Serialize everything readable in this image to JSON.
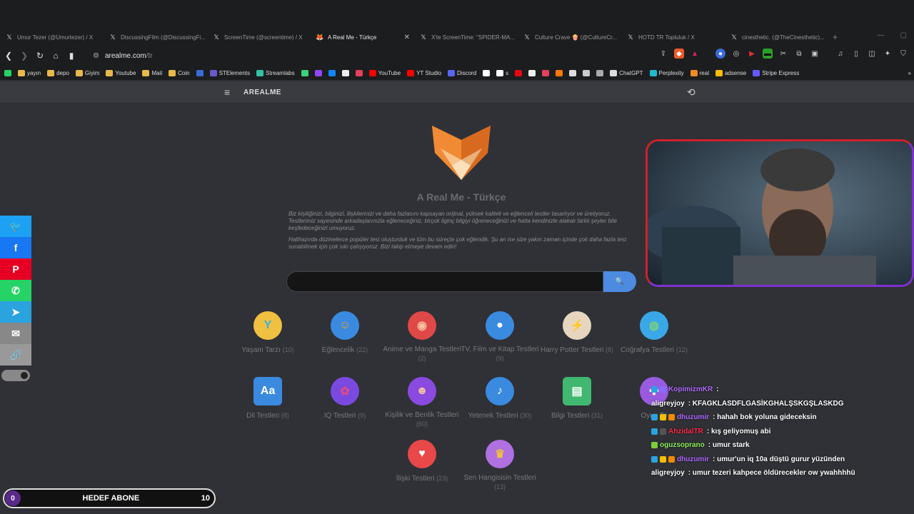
{
  "browser": {
    "tabs": [
      {
        "title": "Umur Tezer (@Umurtezer) / X",
        "icon": "x-icon",
        "active": false
      },
      {
        "title": "DiscussingFilm (@DiscussingFi...",
        "icon": "x-icon",
        "active": false
      },
      {
        "title": "ScreenTime (@screentime) / X",
        "icon": "x-icon",
        "active": false
      },
      {
        "title": "A Real Me - Türkçe",
        "icon": "fox-icon",
        "active": true
      },
      {
        "title": "X'te ScreenTime: \"SPIDER-MA...",
        "icon": "x-icon",
        "active": false
      },
      {
        "title": "Culture Crave 🍿 (@CultureCr...",
        "icon": "x-icon",
        "active": false
      },
      {
        "title": "HOTD TR Topluluk / X",
        "icon": "x-icon",
        "active": false
      },
      {
        "title": "cinesthetic. (@TheCinesthetic)...",
        "icon": "x-icon",
        "active": false
      }
    ],
    "url_host": "arealme.com",
    "url_path": "/tr",
    "bookmarks": [
      {
        "label": "",
        "color": "#25d366"
      },
      {
        "label": "yayın",
        "color": "#e8b84a"
      },
      {
        "label": "depo",
        "color": "#e8b84a"
      },
      {
        "label": "Giyim",
        "color": "#e8b84a"
      },
      {
        "label": "Youtube",
        "color": "#e8b84a"
      },
      {
        "label": "Mail",
        "color": "#e8b84a"
      },
      {
        "label": "Coin",
        "color": "#e8b84a"
      },
      {
        "label": "",
        "color": "#3a6ad8"
      },
      {
        "label": "STElements",
        "color": "#6a5acd"
      },
      {
        "label": "Streamlabs",
        "color": "#31c3a2"
      },
      {
        "label": "",
        "color": "#38d27a"
      },
      {
        "label": "",
        "color": "#9146ff"
      },
      {
        "label": "",
        "color": "#1185fe"
      },
      {
        "label": "",
        "color": "#eeeeee"
      },
      {
        "label": "",
        "color": "#e4405f"
      },
      {
        "label": "YouTube",
        "color": "#ff0000"
      },
      {
        "label": "YT Studio",
        "color": "#ff0000"
      },
      {
        "label": "Discord",
        "color": "#5865f2"
      },
      {
        "label": "",
        "color": "#ffffff"
      },
      {
        "label": "s",
        "color": "#ffffff"
      },
      {
        "label": "",
        "color": "#e50914"
      },
      {
        "label": "",
        "color": "#eeeeee"
      },
      {
        "label": "",
        "color": "#e4405f"
      },
      {
        "label": "",
        "color": "#ff7a00"
      },
      {
        "label": "",
        "color": "#dddddd"
      },
      {
        "label": "",
        "color": "#cccccc"
      },
      {
        "label": "",
        "color": "#aaaaaa"
      },
      {
        "label": "ChatGPT",
        "color": "#dddddd"
      },
      {
        "label": "Perplexity",
        "color": "#20b8cd"
      },
      {
        "label": "real",
        "color": "#f08a24"
      },
      {
        "label": "adsense",
        "color": "#fbbc04"
      },
      {
        "label": "Stripe Express",
        "color": "#635bff"
      }
    ]
  },
  "site": {
    "brand": "AREALME",
    "title": "A Real Me - Türkçe",
    "intro_p1": "Biz kişiliğinizi, bilginizi, ilişkilerinizi ve daha fazlasını kapsayan orijinal, yüksek kaliteli ve eğlenceli testler tasarlıyor ve üretiyoruz. Testlerimiz sayesinde arkadaşlarınızla eğleneceğiniz, birçok ilginç bilgiyi öğreneceğinizi ve hatta kendinizle alakalı farklı şeyler bile keşfedeceğinizi umuyoruz.",
    "intro_p2": "Halihazırda düzinelerce popüler test oluşturduk ve tüm bu süreçte çok eğlendik. Şu an ise size yakın zaman içinde çok daha fazla test sunabilmek için çok sıkı çalışıyoruz. Bizi takip etmeye devam edin!",
    "search_placeholder": "",
    "categories": [
      {
        "label": "Yaşam Tarzı",
        "count": "(10)"
      },
      {
        "label": "Eğlencelik",
        "count": "(22)"
      },
      {
        "label": "Anime ve Manga Testleri",
        "count": "(2)"
      },
      {
        "label": "TV, Film ve Kitap Testleri",
        "count": "(9)"
      },
      {
        "label": "Harry Potter Testleri",
        "count": "(8)"
      },
      {
        "label": "Coğrafya Testleri",
        "count": "(12)"
      },
      {
        "label": "Dil Testleri",
        "count": "(8)"
      },
      {
        "label": "IQ Testleri",
        "count": "(9)"
      },
      {
        "label": "Kişilik ve Benlik Testleri",
        "count": "(60)"
      },
      {
        "label": "Yetenek Testleri",
        "count": "(30)"
      },
      {
        "label": "Bilgi Testleri",
        "count": "(31)"
      },
      {
        "label": "Oyun Te",
        "count": ""
      },
      {
        "label": "İlişki Testleri",
        "count": "(23)"
      },
      {
        "label": "Sen Hangisisin Testleri",
        "count": "(13)"
      }
    ]
  },
  "share": [
    {
      "name": "twitter",
      "color": "#1da1f2",
      "glyph": "🐦"
    },
    {
      "name": "facebook",
      "color": "#1877f2",
      "glyph": "f"
    },
    {
      "name": "pinterest",
      "color": "#e60023",
      "glyph": "P"
    },
    {
      "name": "whatsapp",
      "color": "#25d366",
      "glyph": "✆"
    },
    {
      "name": "telegram",
      "color": "#2aa3df",
      "glyph": "➤"
    },
    {
      "name": "email",
      "color": "#888888",
      "glyph": "✉"
    },
    {
      "name": "link",
      "color": "#999999",
      "glyph": "🔗"
    }
  ],
  "chat": [
    {
      "user": "KopimizmKR",
      "color": "#b06bff",
      "text": ":",
      "badges": [
        "#2aa3df",
        "#8a6bff"
      ]
    },
    {
      "user": "aligreyjoy",
      "color": "#ffffff",
      "text": ": KFAGKLASDFLGASİKGHALŞSKGŞLASKDG",
      "badges": []
    },
    {
      "user": "dhuzumir",
      "color": "#b06bff",
      "text": ": hahah bok yoluna gideceksin",
      "badges": [
        "#2aa3df",
        "#f0c000",
        "#f08a00"
      ]
    },
    {
      "user": "AhzidalTR",
      "color": "#ff2a4a",
      "text": ": kış geliyomuş abi",
      "badges": [
        "#2aa3df",
        "#555555"
      ]
    },
    {
      "user": "oguzsoprano",
      "color": "#8ef05a",
      "text": ": umur stark",
      "badges": [
        "#7ad03a"
      ]
    },
    {
      "user": "dhuzumir",
      "color": "#b06bff",
      "text": ": umur'un iq 10a düştü gurur yüzünden",
      "badges": [
        "#2aa3df",
        "#f0c000",
        "#f08a00"
      ]
    },
    {
      "user": "aligreyjoy",
      "color": "#ffffff",
      "text": ": umur tezeri kahpece öldürecekler ow ywahhhhü",
      "badges": []
    }
  ],
  "goal": {
    "current": "0",
    "label": "HEDEF ABONE",
    "target": "10"
  }
}
